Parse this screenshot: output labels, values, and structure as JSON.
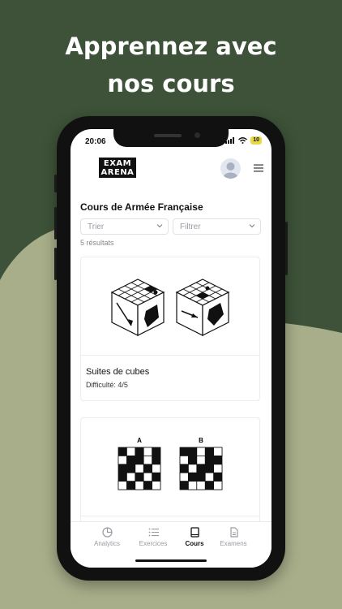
{
  "promo": {
    "headline_line1": "Apprennez avec",
    "headline_line2": "nos cours"
  },
  "status_bar": {
    "time": "20:06",
    "battery": "10"
  },
  "header": {
    "logo_line1": "EXAM",
    "logo_line2": "ARENA"
  },
  "page": {
    "title": "Cours de Armée Française",
    "sort_placeholder": "Trier",
    "filter_placeholder": "Filtrer",
    "results": "5 résultats"
  },
  "courses": [
    {
      "title": "Suites de cubes",
      "difficulty": "Difficulté: 4/5"
    },
    {
      "label_a": "A",
      "label_b": "B"
    }
  ],
  "tabbar": {
    "items": [
      {
        "label": "Analytics",
        "icon": "pie-chart-icon"
      },
      {
        "label": "Exercices",
        "icon": "list-icon"
      },
      {
        "label": "Cours",
        "icon": "book-icon",
        "active": true
      },
      {
        "label": "Examens",
        "icon": "document-icon"
      }
    ]
  },
  "colors": {
    "background": "#3d5238",
    "accent_blob": "#a8ae8a",
    "text": "#111111"
  }
}
